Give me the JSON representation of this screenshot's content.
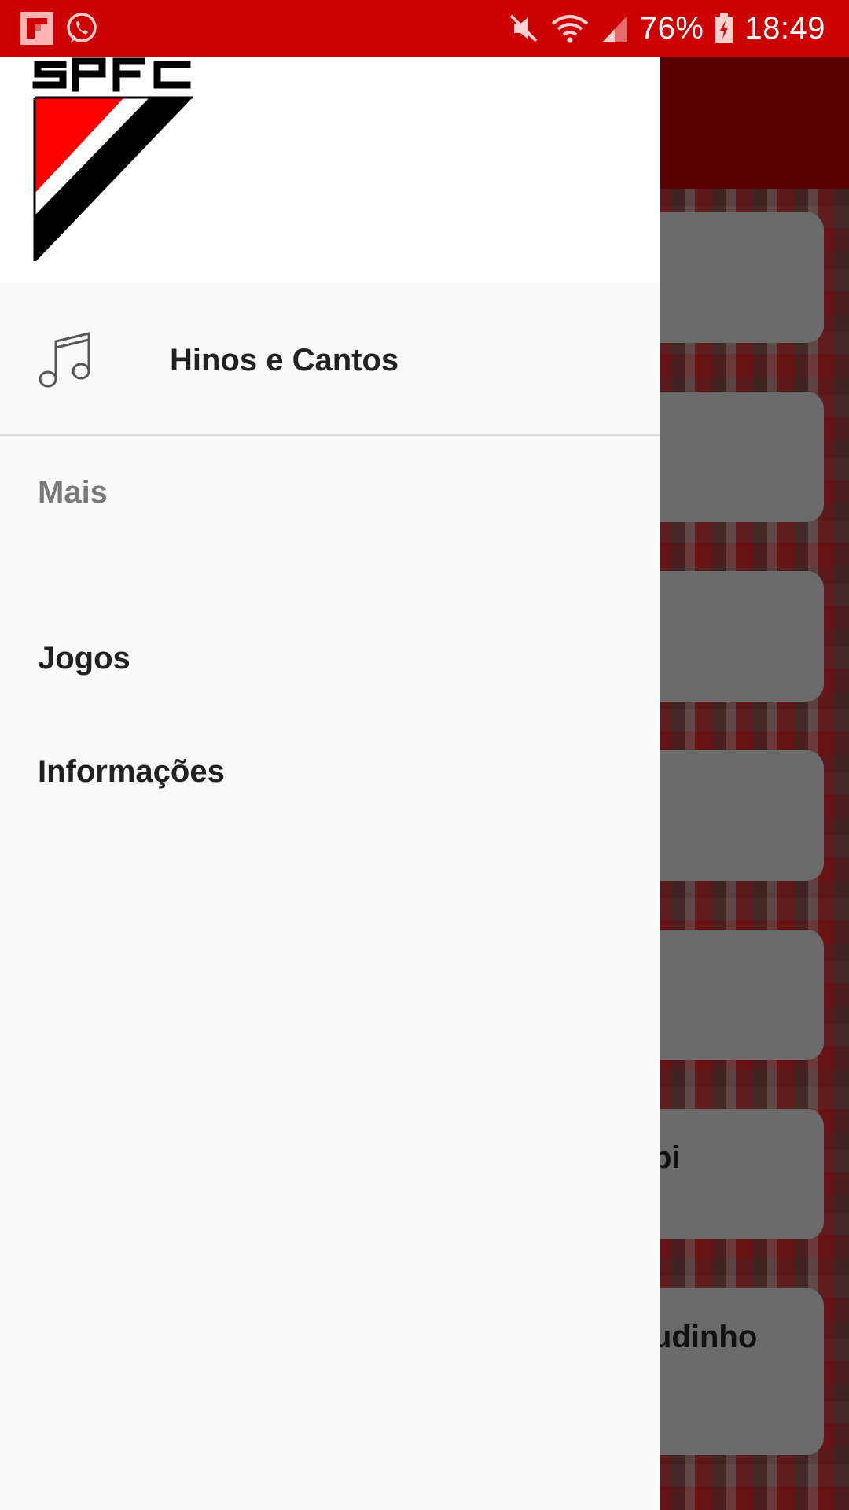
{
  "status_bar": {
    "left_icons": [
      "flipboard-icon",
      "whatsapp-icon"
    ],
    "right_icons": [
      "mute-icon",
      "wifi-icon",
      "signal-icon",
      "battery-charging-icon"
    ],
    "battery": "76%",
    "time": "18:49",
    "background_color": "#cc0000"
  },
  "drawer": {
    "logo": {
      "text": "SPFC",
      "colors": [
        "#ff0000",
        "#000000",
        "#ffffff"
      ]
    },
    "main_item": {
      "icon": "music-note-icon",
      "label": "Hinos e Cantos"
    },
    "section_header": "Mais",
    "items": [
      {
        "label": "Jogos"
      },
      {
        "label": "Informações"
      }
    ]
  },
  "background_list": {
    "cards": [
      "",
      "",
      "",
      "",
      "",
      "pi",
      "udinho"
    ]
  }
}
